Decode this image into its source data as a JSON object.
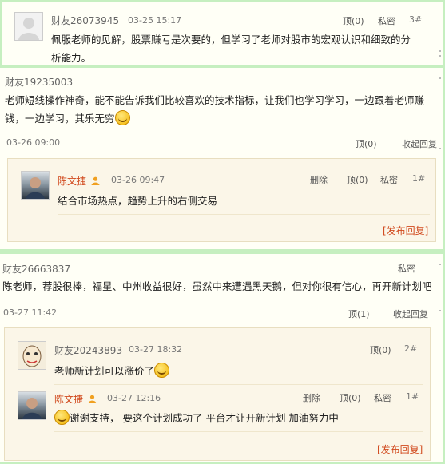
{
  "comments": [
    {
      "author": "财友26073945",
      "time": "03-25 15:17",
      "up": "顶(0)",
      "private": "私密",
      "floor": "3#",
      "text": "佩服老师的见解，股票赚亏是次要的，但学习了老师对股市的宏观认识和细致的分析能力。"
    },
    {
      "author": "财友19235003",
      "text": "老师短线操作神奇，能不能告诉我们比较喜欢的技术指标，让我们也学习学习，一边跟着老师赚钱，一边学习，其乐无穷",
      "time": "03-26 09:00",
      "up": "顶(0)",
      "collapse": "收起回复",
      "replies": [
        {
          "author": "陈文捷",
          "time": "03-26 09:47",
          "delete": "删除",
          "up": "顶(0)",
          "private": "私密",
          "floor": "1#",
          "text": "结合市场热点，趋势上升的右侧交易"
        }
      ],
      "publish": "[发布回复]"
    },
    {
      "author": "财友26663837",
      "private": "私密",
      "text": "陈老师，荐股很棒，福星、中州收益很好，虽然中来遭遇黑天鹅，但对你很有信心，再开新计划吧",
      "time": "03-27 11:42",
      "up": "顶(1)",
      "collapse": "收起回复",
      "replies": [
        {
          "author": "财友20243893",
          "time": "03-27 18:32",
          "up": "顶(0)",
          "floor": "2#",
          "text": "老师新计划可以涨价了"
        },
        {
          "author": "陈文捷",
          "time": "03-27 12:16",
          "delete": "删除",
          "up": "顶(0)",
          "private": "私密",
          "floor": "1#",
          "text": "谢谢支持， 要这个计划成功了 平台才让开新计划 加油努力中"
        }
      ],
      "publish": "[发布回复]"
    }
  ],
  "icons": {
    "vip": "person-badge-icon",
    "emoji": "smile-emoji-icon"
  }
}
